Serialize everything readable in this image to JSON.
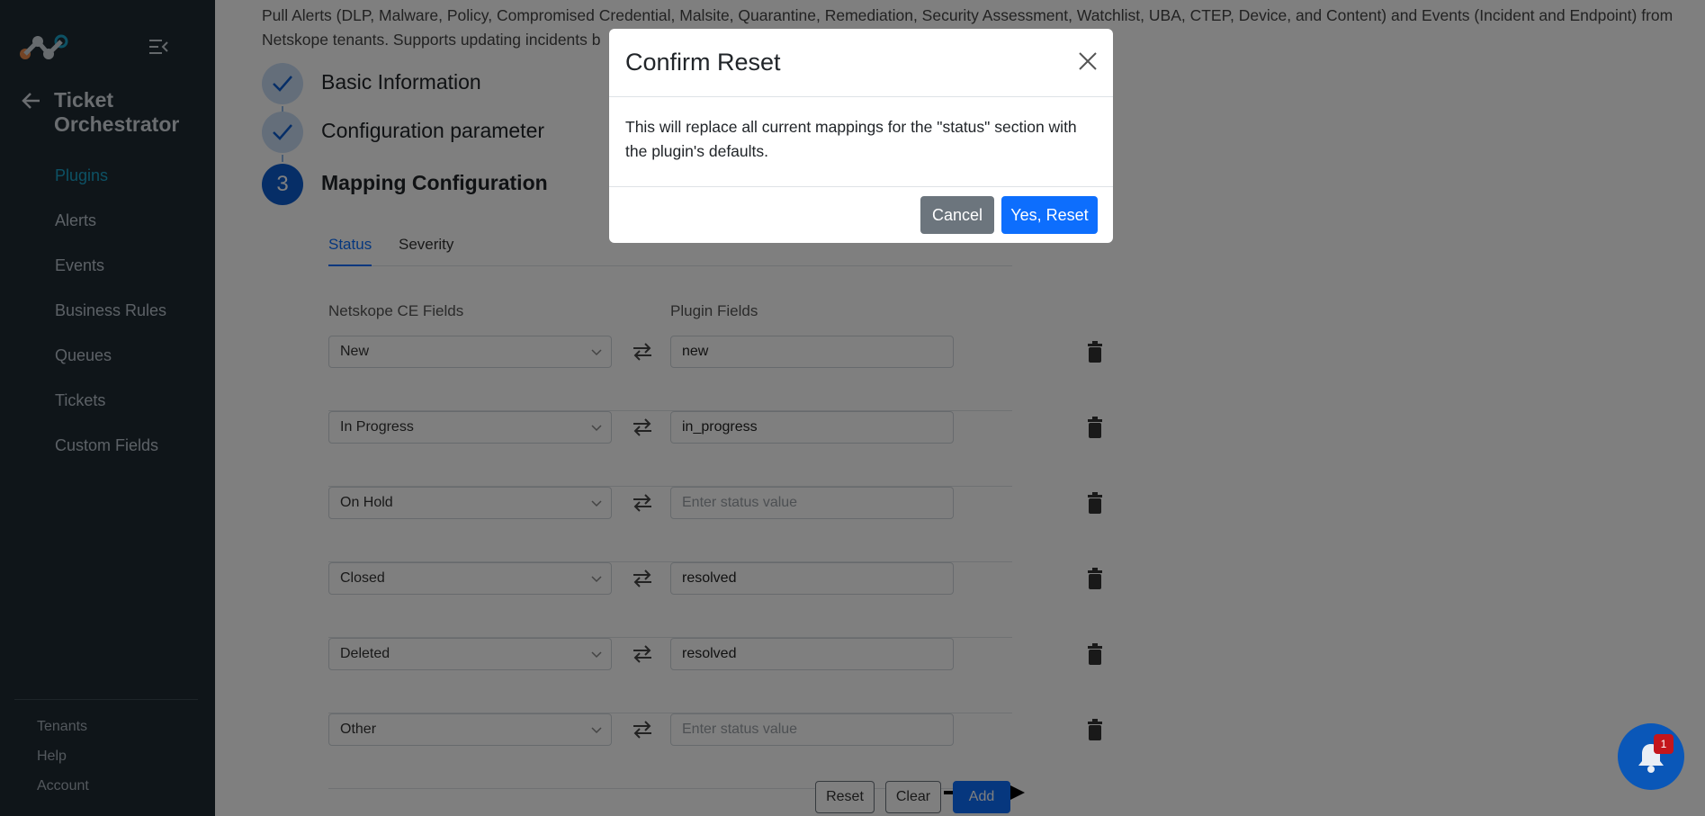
{
  "sidebar": {
    "app_title": "Ticket Orchestrator",
    "nav": [
      "Plugins",
      "Alerts",
      "Events",
      "Business Rules",
      "Queues",
      "Tickets",
      "Custom Fields"
    ],
    "active_nav": "Plugins",
    "bottom": [
      "Tenants",
      "Help",
      "Account"
    ]
  },
  "main": {
    "description": "Pull Alerts (DLP, Malware, Policy, Compromised Credential, Malsite, Quarantine, Remediation, Security Assessment, Watchlist, UBA, CTEP, Device, and Content) and Events (Incident and Endpoint) from Netskope tenants. Supports updating incidents b",
    "steps": [
      {
        "label": "Basic Information",
        "state": "done"
      },
      {
        "label": "Configuration parameter",
        "state": "done"
      },
      {
        "label": "Mapping Configuration",
        "state": "current",
        "number": "3"
      }
    ],
    "tabs": [
      "Status",
      "Severity"
    ],
    "active_tab": "Status",
    "col_ce": "Netskope CE Fields",
    "col_plugin": "Plugin Fields",
    "rows": [
      {
        "ce": "New",
        "plugin": "new"
      },
      {
        "ce": "In Progress",
        "plugin": "in_progress"
      },
      {
        "ce": "On Hold",
        "plugin": ""
      },
      {
        "ce": "Closed",
        "plugin": "resolved"
      },
      {
        "ce": "Deleted",
        "plugin": "resolved"
      },
      {
        "ce": "Other",
        "plugin": ""
      }
    ],
    "placeholder": "Enter status value",
    "buttons": {
      "reset": "Reset",
      "clear": "Clear",
      "add": "Add"
    }
  },
  "modal": {
    "title": "Confirm Reset",
    "body": "This will replace all current mappings for the \"status\" section with the plugin's defaults.",
    "cancel": "Cancel",
    "confirm": "Yes, Reset"
  },
  "notifications": {
    "count": "1"
  },
  "colors": {
    "sidebar_bg": "#1e2a33",
    "accent": "#0d6efd",
    "active_nav": "#1aa3c8",
    "step_active": "#0d5ccf"
  }
}
